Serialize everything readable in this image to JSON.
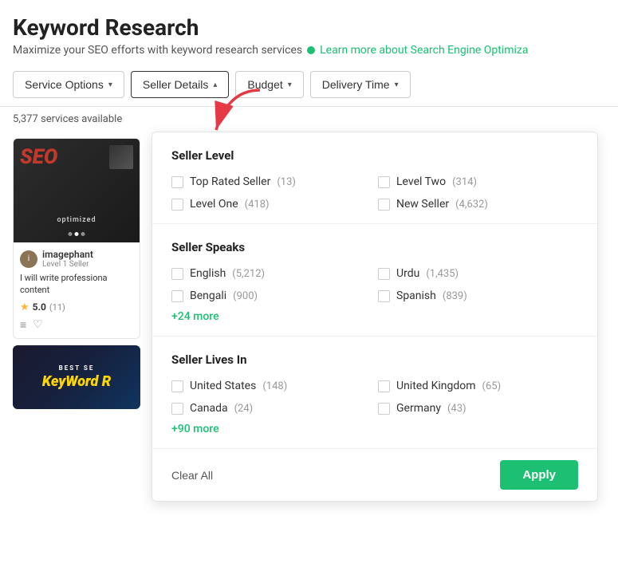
{
  "header": {
    "title": "Keyword Research",
    "subtitle": "Maximize your SEO efforts with keyword research services",
    "learn_more": "Learn more about Search Engine Optimiza"
  },
  "filters": {
    "service_options": "Service Options",
    "seller_details": "Seller Details",
    "budget": "Budget",
    "delivery_time": "Delivery Time"
  },
  "results_count": "5,377 services available",
  "card": {
    "seller_name": "imagephant",
    "seller_level": "Level 1 Seller",
    "title": "I will write professiona content",
    "rating": "5.0",
    "review_count": "(11)"
  },
  "dropdown": {
    "seller_level_title": "Seller Level",
    "seller_speaks_title": "Seller Speaks",
    "seller_lives_title": "Seller Lives In",
    "items": {
      "seller_level": [
        {
          "label": "Top Rated Seller",
          "count": "(13)"
        },
        {
          "label": "Level Two",
          "count": "(314)"
        },
        {
          "label": "Level One",
          "count": "(418)"
        },
        {
          "label": "New Seller",
          "count": "(4,632)"
        }
      ],
      "seller_speaks": [
        {
          "label": "English",
          "count": "(5,212)"
        },
        {
          "label": "Urdu",
          "count": "(1,435)"
        },
        {
          "label": "Bengali",
          "count": "(900)"
        },
        {
          "label": "Spanish",
          "count": "(839)"
        }
      ],
      "seller_lives": [
        {
          "label": "United States",
          "count": "(148)"
        },
        {
          "label": "United Kingdom",
          "count": "(65)"
        },
        {
          "label": "Canada",
          "count": "(24)"
        },
        {
          "label": "Germany",
          "count": "(43)"
        }
      ]
    },
    "speaks_more": "+24 more",
    "lives_more": "+90 more",
    "clear_all": "Clear All",
    "apply": "Apply"
  }
}
